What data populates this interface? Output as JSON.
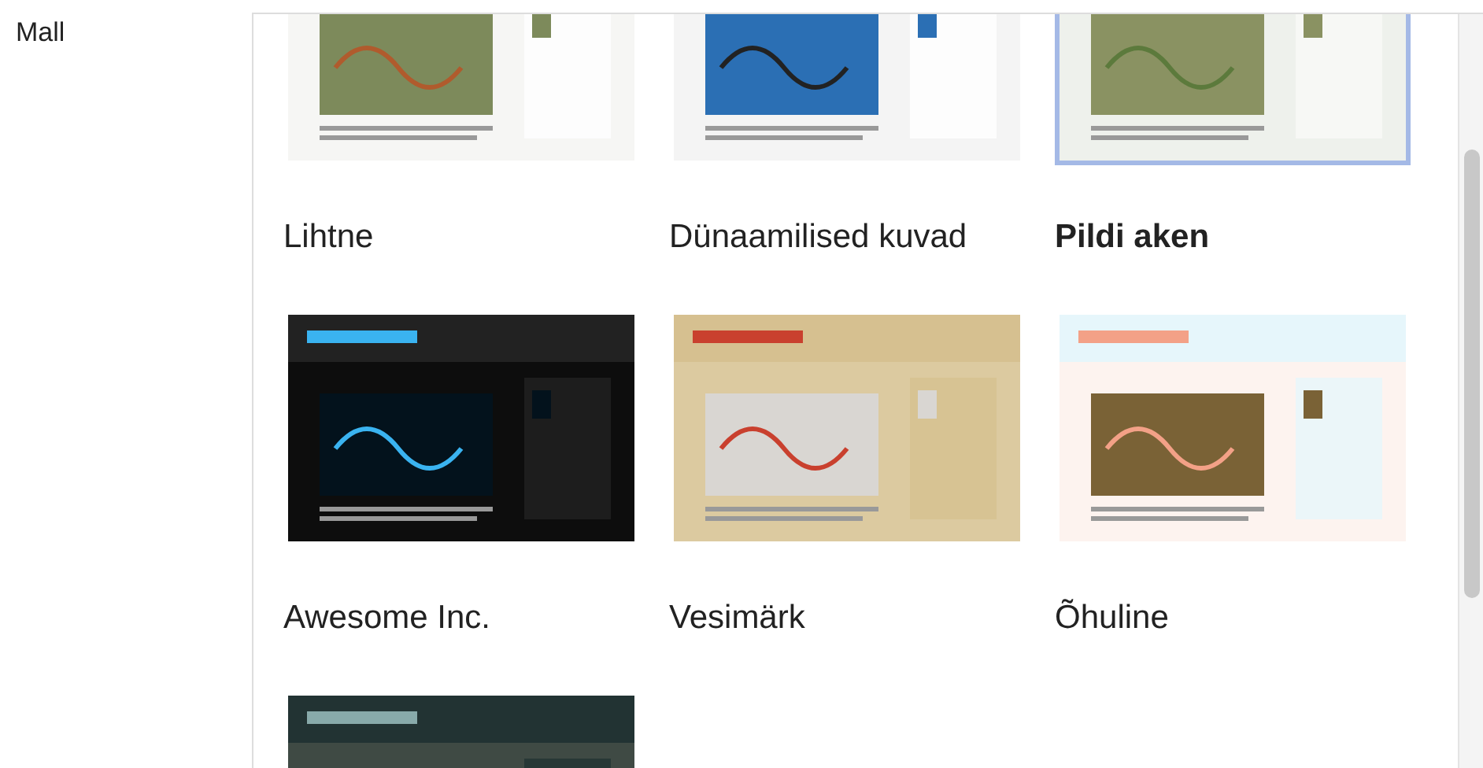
{
  "field_label": "Mall",
  "templates": [
    {
      "name": "Lihtne",
      "selected": false,
      "kind": "simple"
    },
    {
      "name": "Dünaamilised kuvad",
      "selected": false,
      "kind": "dynamic"
    },
    {
      "name": "Pildi aken",
      "selected": true,
      "kind": "picture"
    },
    {
      "name": "Awesome Inc.",
      "selected": false,
      "kind": "dark"
    },
    {
      "name": "Vesimärk",
      "selected": false,
      "kind": "watermark"
    },
    {
      "name": "Õhuline",
      "selected": false,
      "kind": "ethereal"
    },
    {
      "selected": false,
      "kind": "travel"
    }
  ]
}
